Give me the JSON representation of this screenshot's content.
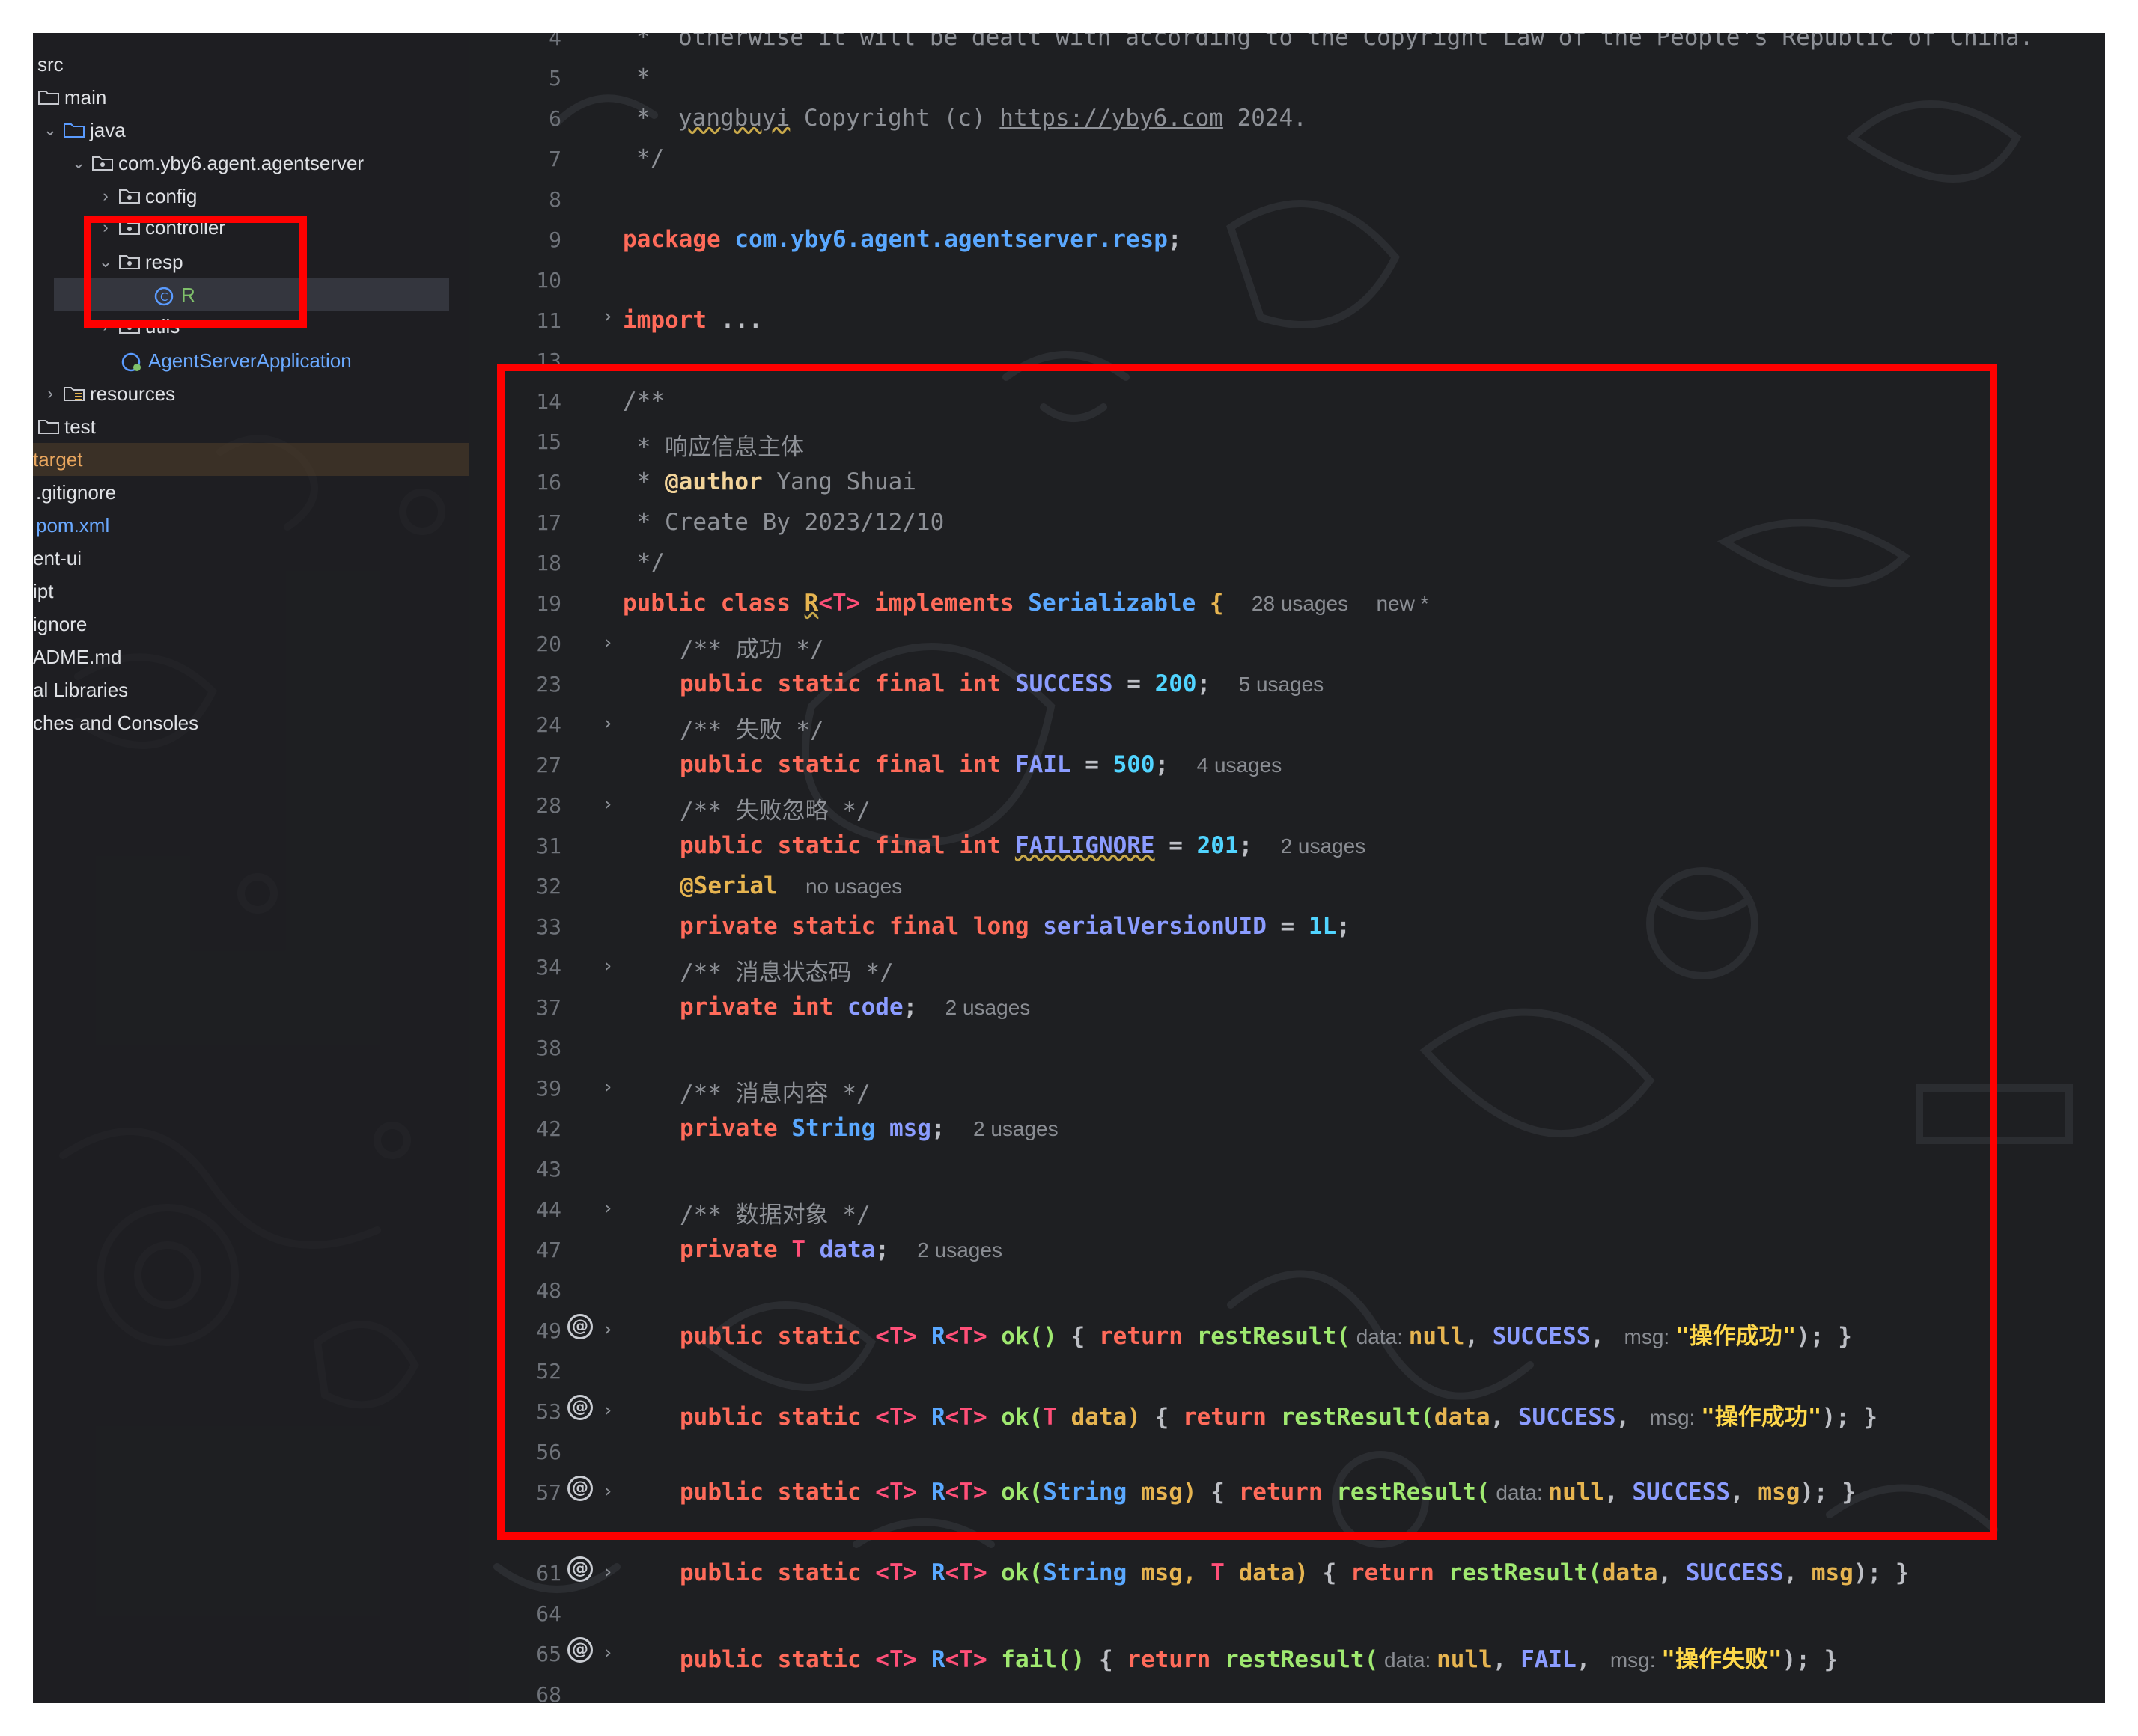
{
  "colors": {
    "highlight": "#ff0000",
    "background": "#1e1f22"
  },
  "tree": {
    "items": [
      {
        "label": "src"
      },
      {
        "label": "main"
      },
      {
        "label": "java"
      },
      {
        "label": "com.yby6.agent.agentserver"
      },
      {
        "label": "config"
      },
      {
        "label": "controller"
      },
      {
        "label": "resp"
      },
      {
        "label": "R"
      },
      {
        "label": "utils"
      },
      {
        "label": "AgentServerApplication"
      },
      {
        "label": "resources"
      },
      {
        "label": "test"
      },
      {
        "label": "target"
      },
      {
        "label": ".gitignore"
      },
      {
        "label": "pom.xml"
      },
      {
        "label": "ent-ui"
      },
      {
        "label": "ipt"
      },
      {
        "label": "ignore"
      },
      {
        "label": "ADME.md"
      },
      {
        "label": "al Libraries"
      },
      {
        "label": "ches and Consoles"
      }
    ]
  },
  "editor": {
    "line_numbers": [
      "4",
      "5",
      "6",
      "7",
      "8",
      "9",
      "10",
      "11",
      "13",
      "14",
      "15",
      "16",
      "17",
      "18",
      "19",
      "20",
      "23",
      "24",
      "27",
      "28",
      "31",
      "32",
      "33",
      "34",
      "37",
      "38",
      "39",
      "42",
      "43",
      "44",
      "47",
      "48",
      "49",
      "52",
      "53",
      "56",
      "57",
      "61",
      "64",
      "65",
      "68"
    ],
    "header": {
      "l4": "*  otherwise it will be dealt with according to the Copyright Law of the People's Republic of China.",
      "l5": "*",
      "l6_star": "*  ",
      "l6_name": "yangbuyi",
      "l6_mid": " Copyright (c) ",
      "l6_url": "https://yby6.com",
      "l6_end": " 2024.",
      "l7": "*/"
    },
    "pkg": {
      "kw": "package ",
      "name": "com.yby6.agent.agentserver.resp",
      "semi": ";"
    },
    "imp": {
      "kw": "import ",
      "rest": "..."
    },
    "doc": {
      "open": "/**",
      "desc": " * 响应信息主体",
      "author_star": " * ",
      "author_tag": "@author",
      "author_name": " Yang Shuai",
      "create": " * Create By 2023/12/10",
      "close": " */"
    },
    "class_line": {
      "mods": "public class ",
      "name": "R",
      "gen": "<T>",
      "impl": " implements ",
      "iface": "Serializable",
      "brace": " {",
      "usages": "28 usages",
      "new": "new *"
    },
    "fields": {
      "c_success": "/** 成功 */",
      "success_mods": "public static final int ",
      "success_name": "SUCCESS",
      "success_eq": " = ",
      "success_val": "200",
      "success_usages": "5 usages",
      "c_fail": "/** 失败 */",
      "fail_mods": "public static final int ",
      "fail_name": "FAIL",
      "fail_eq": " = ",
      "fail_val": "500",
      "fail_usages": "4 usages",
      "c_failignore": "/** 失败忽略 */",
      "fi_mods": "public static final int ",
      "fi_name": "FAILIGNORE",
      "fi_eq": " = ",
      "fi_val": "201",
      "fi_usages": "2 usages",
      "serial_ann": "@Serial",
      "serial_usages": "no usages",
      "svuid_mods": "private static final long ",
      "svuid_name": "serialVersionUID",
      "svuid_eq": " = ",
      "svuid_val": "1L",
      "c_code": "/** 消息状态码 */",
      "code_mods": "private int ",
      "code_name": "code",
      "code_usages": "2 usages",
      "c_msg": "/** 消息内容 */",
      "msg_mods": "private ",
      "msg_type": "String ",
      "msg_name": "msg",
      "msg_usages": "2 usages",
      "c_data": "/** 数据对象 */",
      "data_mods": "private ",
      "data_type": "T ",
      "data_name": "data",
      "data_usages": "2 usages"
    },
    "methods": {
      "mods": "public static ",
      "gen": "<T>",
      "ret_r": " R",
      "ret_gen": "<T>",
      "m1_name": " ok()",
      "m2_name": " ok(",
      "m2_param_type": "T",
      "m2_param": " data)",
      "m3_name": " ok(",
      "m3_param_type": "String",
      "m3_param": " msg)",
      "m4_name": " ok(",
      "m4_param_type": "String",
      "m4_param": " msg, ",
      "m4_param2_type": "T",
      "m4_param2": " data)",
      "m5_name": " fail()",
      "lbrace": " { ",
      "return_kw": "return ",
      "call": "restResult(",
      "hint_data": " data: ",
      "hint_msg": " msg: ",
      "null_kw": "null",
      "comma": ", ",
      "success_const": "SUCCESS",
      "fail_const": "FAIL",
      "ok_msg": "\"操作成功\"",
      "fail_msg": "\"操作失败\"",
      "arg_data": "data",
      "arg_msg": "msg",
      "end": "); }"
    }
  }
}
